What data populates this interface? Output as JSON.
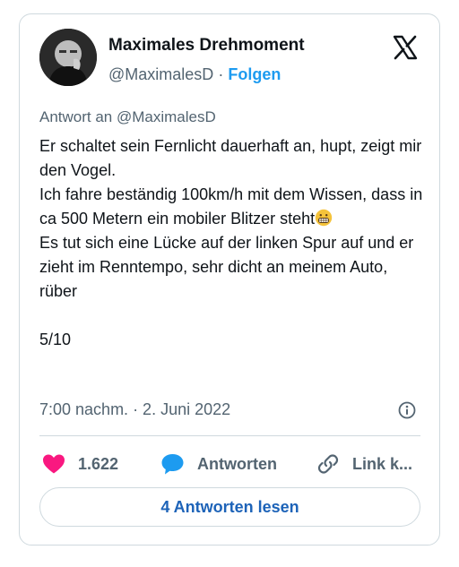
{
  "author": {
    "name": "Maximales Drehmoment",
    "handle": "@MaximalesD",
    "separator": "·",
    "follow_label": "Folgen"
  },
  "icons": {
    "logo": "x-logo-icon",
    "info": "info-icon",
    "like": "heart-icon",
    "reply": "speech-bubble-icon",
    "link": "link-icon"
  },
  "tweet": {
    "reply_to": "Antwort an @MaximalesD",
    "text_part1": "Er schaltet sein Fernlicht dauerhaft an, hupt, zeigt mir den Vogel.\nIch fahre beständig 100km/h mit dem Wissen, dass in ca 500 Metern ein mobiler Blitzer steht",
    "text_part2": "\nEs tut sich eine Lücke auf der linken Spur auf und er zieht im Renntempo, sehr dicht an meinem Auto, rüber\n\n5/10",
    "emoji": "grimacing-face",
    "timestamp": "7:00 nachm. · 2. Juni 2022"
  },
  "actions": {
    "like_count": "1.622",
    "reply_label": "Antworten",
    "link_label": "Link k..."
  },
  "read_replies_label": "4 Antworten lesen",
  "colors": {
    "accent": "#1d9bf0",
    "heart": "#f91880",
    "text_secondary": "#536471",
    "button_text": "#1d63b8"
  }
}
